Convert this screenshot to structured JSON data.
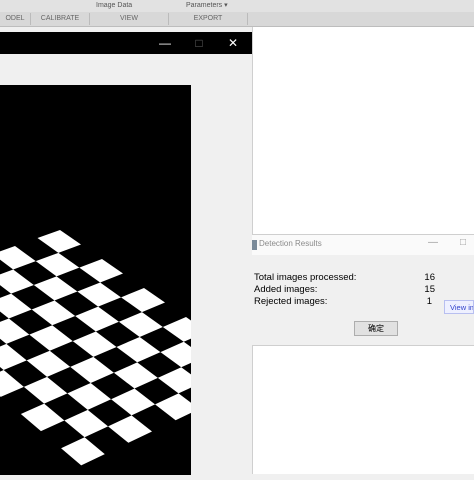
{
  "ribbon": {
    "top_items": [
      "Image Data",
      "Parameters ▾"
    ],
    "sections": [
      "ODEL",
      "CALIBRATE",
      "VIEW",
      "EXPORT"
    ]
  },
  "image_window": {
    "controls": {
      "minimize": "—",
      "maximize": "□",
      "close": "✕"
    }
  },
  "detection_results": {
    "title": "Detection Results",
    "controls": {
      "minimize": "—",
      "maximize": "□"
    },
    "rows": [
      {
        "label": "Total images processed:",
        "value": "16"
      },
      {
        "label": "Added images:",
        "value": "15"
      },
      {
        "label": "Rejected images:",
        "value": "1"
      }
    ],
    "view_button": "View images",
    "ok_button": "确定"
  }
}
